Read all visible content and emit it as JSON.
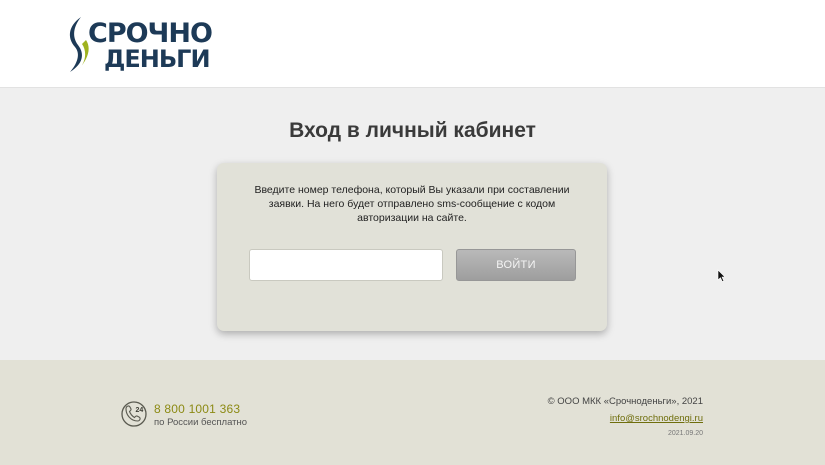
{
  "header": {
    "logo": {
      "line1": "СРОЧНО",
      "line2": "ДЕНЬГИ"
    }
  },
  "main": {
    "title": "Вход в личный кабинет",
    "description": "Введите номер телефона, который Вы указали при составлении заявки. На него будет отправлено sms-сообщение с кодом авторизации на сайте.",
    "phone_input": {
      "value": "",
      "placeholder": ""
    },
    "login_button": "ВОЙТИ"
  },
  "footer": {
    "phone_icon_label": "24",
    "phone": "8 800 1001 363",
    "phone_note": "по России бесплатно",
    "copyright": "© ООО МКК «Срочноденьги», 2021",
    "email": "info@srochnodengi.ru",
    "version": "2021.09.20"
  },
  "colors": {
    "logo_dark": "#1d3a57",
    "logo_accent": "#9fb21f",
    "card_bg": "#e1e1d8",
    "footer_bg": "#e2e1d6",
    "phone_accent": "#8c8a14",
    "button_gray": "#a8a8a8"
  },
  "icons": [
    "logo-mark-icon",
    "phone-24-icon",
    "mouse-cursor-icon"
  ]
}
